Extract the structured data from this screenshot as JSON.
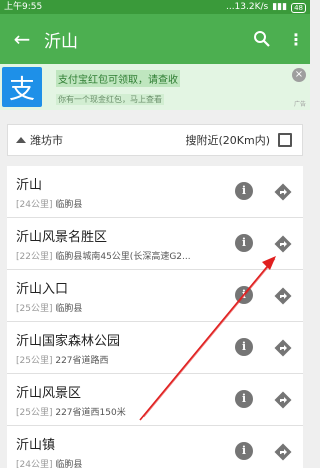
{
  "status": {
    "time": "上午9:55",
    "net": "...13.2K/s",
    "battery": "48"
  },
  "appbar": {
    "back_icon": "back-arrow-icon",
    "title": "沂山",
    "search_icon": "search-icon",
    "more_icon": "more-vert-icon"
  },
  "ad": {
    "logo": "支",
    "title": "支付宝红包可领取，请查收",
    "subtitle": "你有一个现金红包，马上查看",
    "close": "×",
    "badge": "广告"
  },
  "filter": {
    "city": "潍坊市",
    "nearby_label": "搜附近(20Km内)"
  },
  "results": [
    {
      "name": "沂山",
      "distance": "[24公里]",
      "address": "临朐县"
    },
    {
      "name": "沂山风景名胜区",
      "distance": "[22公里]",
      "address": "临朐县城南45公里(长深高速G2..."
    },
    {
      "name": "沂山入口",
      "distance": "[25公里]",
      "address": "临朐县"
    },
    {
      "name": "沂山国家森林公园",
      "distance": "[25公里]",
      "address": "227省道路西"
    },
    {
      "name": "沂山风景区",
      "distance": "[25公里]",
      "address": "227省道西150米"
    },
    {
      "name": "沂山镇",
      "distance": "[24公里]",
      "address": "临朐县"
    }
  ],
  "colors": {
    "appbar": "#4caf50",
    "statusbar": "#3a9a3a",
    "annotation": "#e01f1f"
  }
}
